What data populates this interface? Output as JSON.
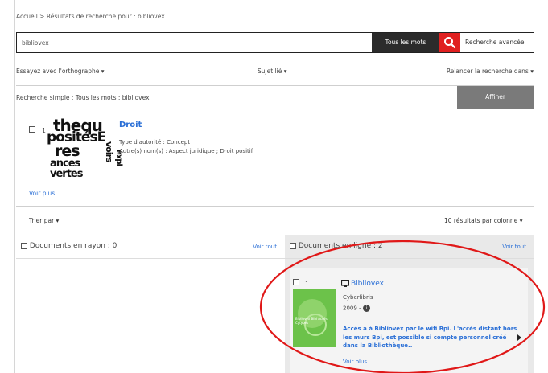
{
  "breadcrumb": {
    "home": "Accueil",
    "separator": ">",
    "current": "Résultats de recherche pour : bibliovex"
  },
  "search": {
    "value": "bibliovex",
    "mode": "Tous les mots",
    "advanced": "Recherche avancée"
  },
  "options": {
    "spelling": "Essayez avec l'orthographe ▾",
    "subject": "Sujet lié ▾",
    "relaunch": "Relancer la recherche dans ▾"
  },
  "simple_search": {
    "text": "Recherche simple :   Tous les mots : bibliovex",
    "refine": "Affiner"
  },
  "result1": {
    "index": "1",
    "title": "Droit",
    "type": "Type d'autorité : Concept",
    "other_names": "Autre(s) nom(s) : Aspect juridique ; Droit positif",
    "more": "Voir plus",
    "thumb_words": [
      "thequ",
      "positésE",
      "res",
      "ances",
      "vertes",
      "voirs",
      "expl"
    ]
  },
  "sort": {
    "label": "Trier par ▾",
    "per_column": "10 résultats par colonne ▾"
  },
  "col_left": {
    "label": "Documents en rayon : 0",
    "see_all": "Voir tout"
  },
  "col_right": {
    "label": "Documents en ligne : 2",
    "see_all": "Voir tout",
    "item": {
      "index": "1",
      "title": "Bibliovex",
      "publisher": "Cyberlibris",
      "year": "2009 -",
      "description": "Accès à à Bibliovex par le wifi Bpi. L'accès distant hors les murs Bpi, est possible si compte personnel créé dans la Bibliothèque..",
      "more": "Voir plus",
      "thumb_text": "Bibliovex Bibl Accès Cytypes"
    }
  },
  "colors": {
    "accent_red": "#e02020",
    "link_blue": "#2a6fd6",
    "dark_bar": "#2b2b2b",
    "refine_grey": "#7a7a7a",
    "thumb_green": "#6cc24a",
    "annotation": "#e01818"
  }
}
